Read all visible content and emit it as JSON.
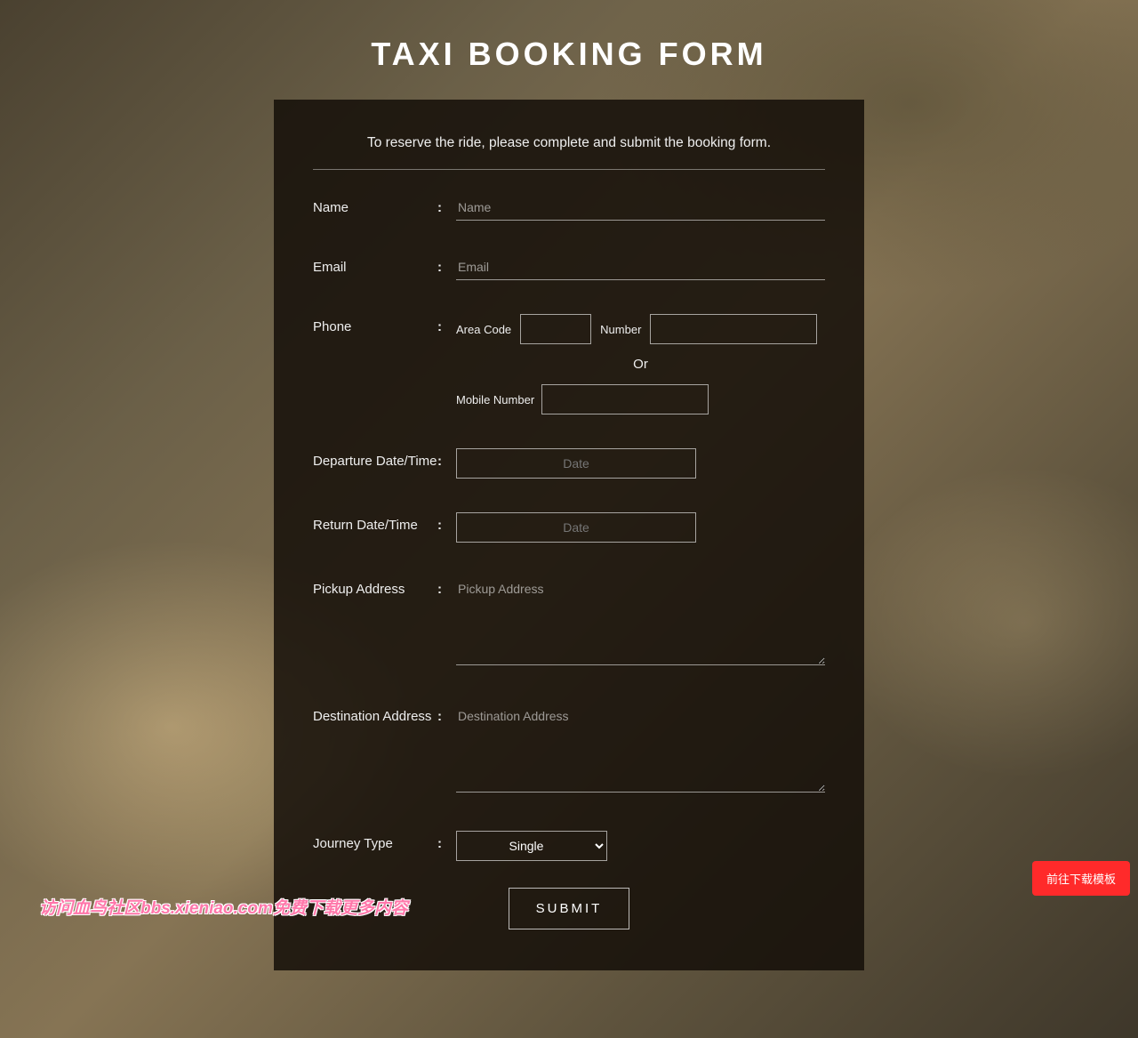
{
  "header": {
    "title": "TAXI BOOKING FORM"
  },
  "intro": "To reserve the ride, please complete and submit the booking form.",
  "fields": {
    "name": {
      "label": "Name",
      "placeholder": "Name"
    },
    "email": {
      "label": "Email",
      "placeholder": "Email"
    },
    "phone": {
      "label": "Phone",
      "area_code_label": "Area Code",
      "number_label": "Number",
      "or_text": "Or",
      "mobile_label": "Mobile Number"
    },
    "departure": {
      "label": "Departure Date/Time",
      "placeholder": "Date"
    },
    "return": {
      "label": "Return Date/Time",
      "placeholder": "Date"
    },
    "pickup": {
      "label": "Pickup Address",
      "placeholder": "Pickup Address"
    },
    "destination": {
      "label": "Destination Address",
      "placeholder": "Destination Address"
    },
    "journey": {
      "label": "Journey Type",
      "selected": "Single"
    }
  },
  "submit_label": "SUBMIT",
  "cta_button": "前往下载模板",
  "watermark": "访问血鸟社区bbs.xieniao.com免费下载更多内容"
}
